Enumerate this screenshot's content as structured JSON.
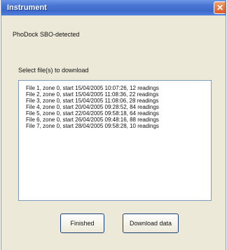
{
  "window": {
    "title": "Instrument"
  },
  "status": {
    "detected_text": "PhoDock SBO-detected"
  },
  "list": {
    "label": "Select file(s) to download",
    "items": [
      "File 1, zone 0, start 15/04/2005 10:07:26, 12 readings",
      "File 2, zone 0, start 15/04/2005 11:08:36, 22 readings",
      "File 3, zone 0, start 15/04/2005 11:08:06, 28 readings",
      "File 4, zone 0, start 20/04/2005 09:28:52, 84 readings",
      "File 5, zone 0, start 22/04/2005 09:58:18, 64 readings",
      "File 6, zone 0, start 26/04/2005 09:48:16, 88 readings",
      "File 7, zone 0, start 28/04/2005 09:58:28, 10 readings"
    ]
  },
  "buttons": {
    "finished": "Finished",
    "download": "Download data"
  }
}
